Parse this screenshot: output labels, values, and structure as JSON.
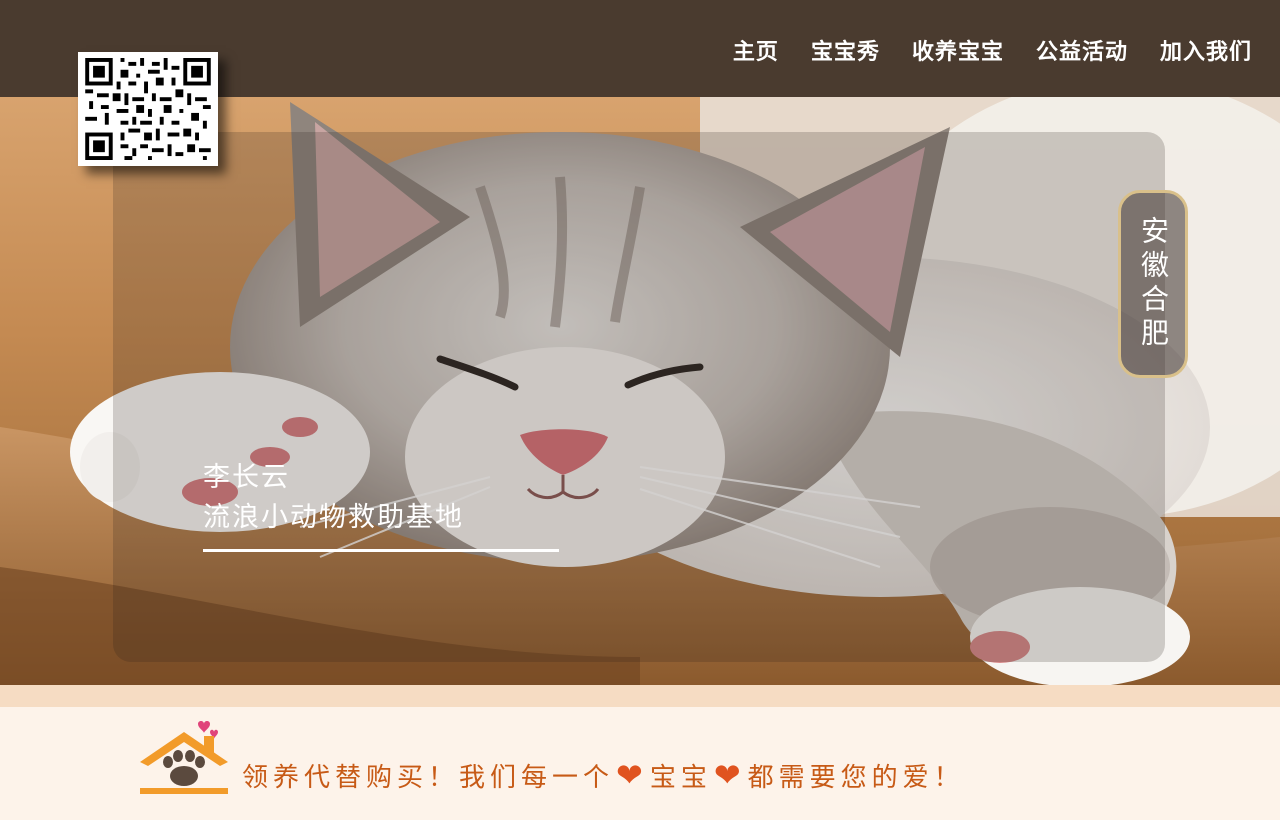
{
  "nav": {
    "items": [
      "主页",
      "宝宝秀",
      "收养宝宝",
      "公益活动",
      "加入我们"
    ]
  },
  "qr": {
    "icon": "qr-code-icon"
  },
  "hero": {
    "location": "安徽合肥",
    "name": "李长云",
    "org": "流浪小动物救助基地"
  },
  "footer": {
    "slogan_part1": "领养代替购买！我们每一个",
    "slogan_part2": "宝宝",
    "slogan_part3": "都需要您的爱！",
    "heart_icon": "heart-icon",
    "logo_icon": "pet-house-paw-icon"
  },
  "colors": {
    "topbar": "#4a3b2f",
    "slogan": "#c75a16",
    "accent_orange": "#e8962e",
    "badge_border": "#d9c08a"
  }
}
